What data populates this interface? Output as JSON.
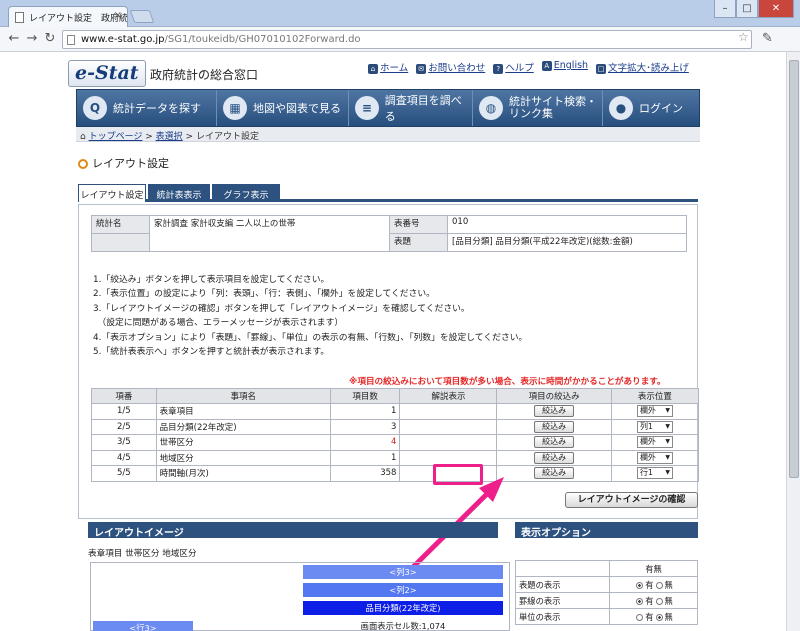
{
  "browser": {
    "tab_title": "レイアウト設定　政府統計",
    "url_host": "www.e-stat.go.jp",
    "url_path": "/SG1/toukeidb/GH07010102Forward.do"
  },
  "header": {
    "logo": "e-Stat",
    "site_name": "政府統計の総合窓口",
    "links": [
      {
        "icon": "⌂",
        "label": "ホーム"
      },
      {
        "icon": "✉",
        "label": "お問い合わせ"
      },
      {
        "icon": "?",
        "label": "ヘルプ"
      },
      {
        "icon": "A",
        "label": "English"
      },
      {
        "icon": "□",
        "label": "文字拡大･読み上げ"
      }
    ]
  },
  "nav": [
    {
      "icon": "Q",
      "label": "統計データを探す"
    },
    {
      "icon": "▦",
      "label": "地図や図表で見る"
    },
    {
      "icon": "≡",
      "label": "調査項目を調べる"
    },
    {
      "icon": "◍",
      "label": "統計サイト検索・\nリンク集"
    },
    {
      "icon": "●",
      "label": "ログイン"
    }
  ],
  "breadcrumb": {
    "home": "トップページ",
    "sep1": " > ",
    "link": "表選択",
    "sep2": " > ",
    "current": "レイアウト設定"
  },
  "page_title": "レイアウト設定",
  "tabs": [
    "レイアウト設定",
    "統計表表示",
    "グラフ表示"
  ],
  "info": {
    "stat_name_label": "統計名",
    "stat_name": "家計調査 家計収支編 二人以上の世帯",
    "table_no_label": "表番号",
    "table_no": "010",
    "table_label": "表題",
    "table_title": "[品目分類] 品目分類(平成22年改定)(総数:金額)"
  },
  "instructions": [
    "1.「絞込み」ボタンを押して表示項目を設定してください。",
    "2.「表示位置」の設定により「列：表頭」、「行：表側」、「欄外」を設定してください。",
    "3.「レイアウトイメージの確認」ボタンを押して「レイアウトイメージ」を確認してください。",
    "　（設定に問題がある場合、エラーメッセージが表示されます）",
    "4.「表示オプション」により「表題」、「罫線」、「単位」の表示の有無、「行数」、「列数」を設定してください。",
    "5.「統計表表示へ」ボタンを押すと統計表が表示されます。"
  ],
  "warning": "※項目の絞込みにおいて項目数が多い場合、表示に時間がかかることがあります。",
  "items_table": {
    "headers": [
      "項番",
      "事項名",
      "項目数",
      "解説表示",
      "項目の絞込み",
      "表示位置"
    ],
    "rows": [
      {
        "no": "1/5",
        "name": "表章項目",
        "count": "1",
        "red": false,
        "button": "絞込み",
        "pos": "欄外"
      },
      {
        "no": "2/5",
        "name": "品目分類(22年改定)",
        "count": "3",
        "red": false,
        "button": "絞込み",
        "pos": "列1"
      },
      {
        "no": "3/5",
        "name": "世帯区分",
        "count": "4",
        "red": true,
        "button": "絞込み",
        "pos": "欄外"
      },
      {
        "no": "4/5",
        "name": "地域区分",
        "count": "1",
        "red": false,
        "button": "絞込み",
        "pos": "欄外"
      },
      {
        "no": "5/5",
        "name": "時間軸(月次)",
        "count": "358",
        "red": false,
        "button": "絞込み",
        "pos": "行1"
      }
    ]
  },
  "confirm_button": "レイアウトイメージの確認",
  "layout": {
    "header": "レイアウトイメージ",
    "items": "表章項目 世帯区分 地域区分",
    "col3": "<列3>",
    "col2": "<列2>",
    "col1": "品目分類(22年改定)",
    "row3": "<行3>",
    "cells": "画面表示セル数:1,074"
  },
  "options": {
    "header": "表示オプション",
    "col_header": "有無",
    "rows": [
      {
        "label": "表題の表示",
        "yes": "有",
        "no": "無",
        "selected": "yes"
      },
      {
        "label": "罫線の表示",
        "yes": "有",
        "no": "無",
        "selected": "yes"
      },
      {
        "label": "単位の表示",
        "yes": "有",
        "no": "無",
        "selected": "no"
      }
    ]
  },
  "colors": {
    "nav": "#274f7f",
    "highlight": "#ee1f8a",
    "warning": "#e52828"
  }
}
